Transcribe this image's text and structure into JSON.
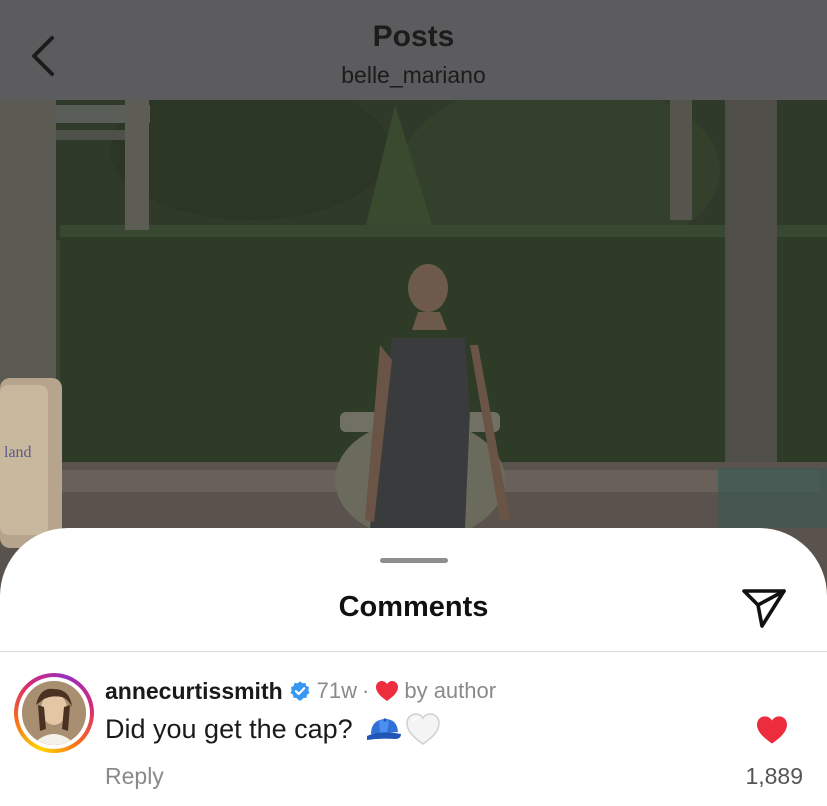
{
  "header": {
    "title": "Posts",
    "username": "belle_mariano"
  },
  "icons": {
    "back": "chevron-left-icon",
    "share": "send-icon",
    "verified": "verified-badge-icon",
    "like": "heart-icon"
  },
  "colors": {
    "heart_red": "#ff3040",
    "verified_blue": "#3897f0",
    "meta_gray": "#8a8a8a"
  },
  "comments_sheet": {
    "title": "Comments",
    "comment": {
      "username": "annecurtissmith",
      "verified": true,
      "time": "71w",
      "separator": "·",
      "liked_by_author_label": "by author",
      "text": "Did you get the cap?",
      "emojis": [
        "blue cap",
        "white heart"
      ],
      "reply_label": "Reply",
      "like_count": "1,889",
      "liked": true
    }
  }
}
